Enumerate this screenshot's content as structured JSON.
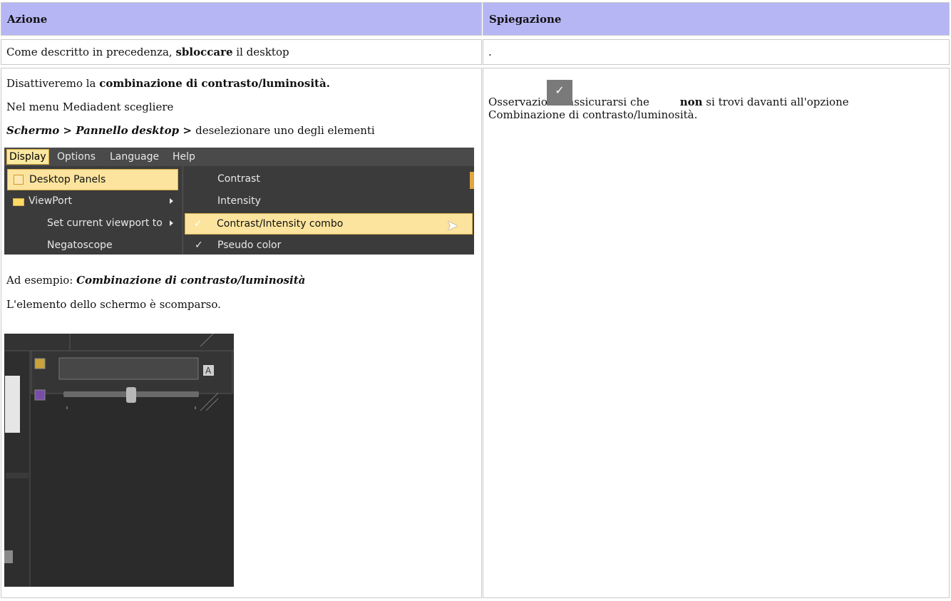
{
  "headers": {
    "action": "Azione",
    "explanation": "Spiegazione"
  },
  "row1": {
    "action_prefix": "Come descritto in precedenza, ",
    "action_bold": "sbloccare",
    "action_suffix": " il desktop",
    "explanation": "."
  },
  "row2": {
    "line1_prefix": "Disattiveremo la ",
    "line1_bold": "combinazione di contrasto/luminosità.",
    "line2": "Nel menu Mediadent scegliere",
    "line3_item1": "Schermo",
    "line3_sep1": " > ",
    "line3_item2": "Pannello desktop",
    "line3_sep2": " > ",
    "line3_suffix": "deselezionare uno degli elementi",
    "example_prefix": "Ad esempio: ",
    "example_bold": "Combinazione di contrasto/luminosità",
    "result": "L'elemento dello schermo è scomparso.",
    "note_prefix": "Osservazione: assicurarsi che ",
    "note_bold": "non",
    "note_suffix": " si trovi davanti all'opzione",
    "note_line2": "Combinazione di contrasto/luminosità."
  },
  "menu": {
    "bar": [
      "Display",
      "Options",
      "Language",
      "Help"
    ],
    "display_items": [
      "Desktop Panels",
      "ViewPort",
      "Set current viewport to",
      "Negatoscope"
    ],
    "desktop_panels": [
      "Contrast",
      "Intensity",
      "Contrast/Intensity combo",
      "Pseudo color"
    ]
  },
  "panel": {
    "label_a": "A"
  }
}
